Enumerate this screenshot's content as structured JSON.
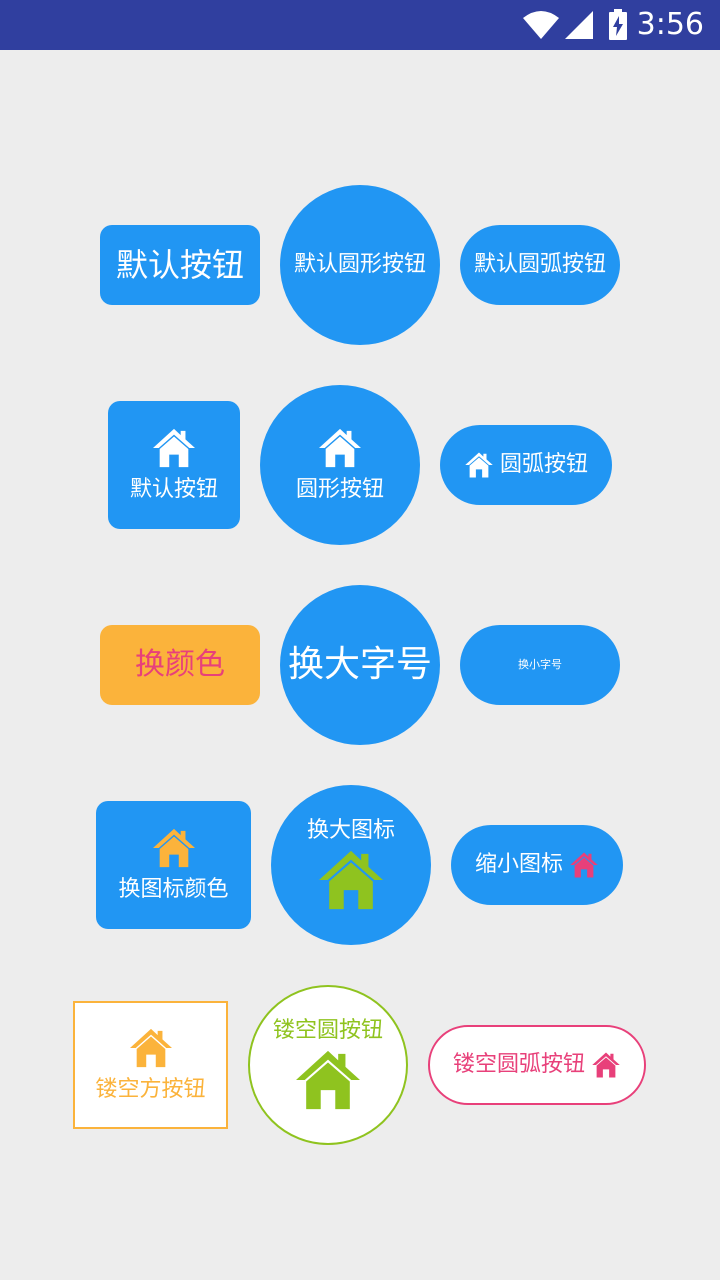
{
  "status_bar": {
    "time": "3:56"
  },
  "colors": {
    "primary": "#2196f3",
    "status_bar": "#303f9f",
    "background": "#ededed",
    "orange": "#fbb33b",
    "green": "#8fc31f",
    "pink": "#e8407a",
    "white": "#ffffff"
  },
  "buttons": {
    "default_label": "默认按钮",
    "default_circle_label": "默认圆形按钮",
    "default_pill_label": "默认圆弧按钮",
    "icon_default_label": "默认按钮",
    "icon_circle_label": "圆形按钮",
    "icon_pill_label": "圆弧按钮",
    "change_color_label": "换颜色",
    "bigger_text_label": "换大字号",
    "smaller_text_label": "换小字号",
    "icon_color_label": "换图标颜色",
    "bigger_icon_label": "换大图标",
    "smaller_icon_label": "缩小图标",
    "hollow_square_label": "镂空方按钮",
    "hollow_circle_label": "镂空圆按钮",
    "hollow_pill_label": "镂空圆弧按钮"
  },
  "icons": {
    "home": "home-icon"
  }
}
